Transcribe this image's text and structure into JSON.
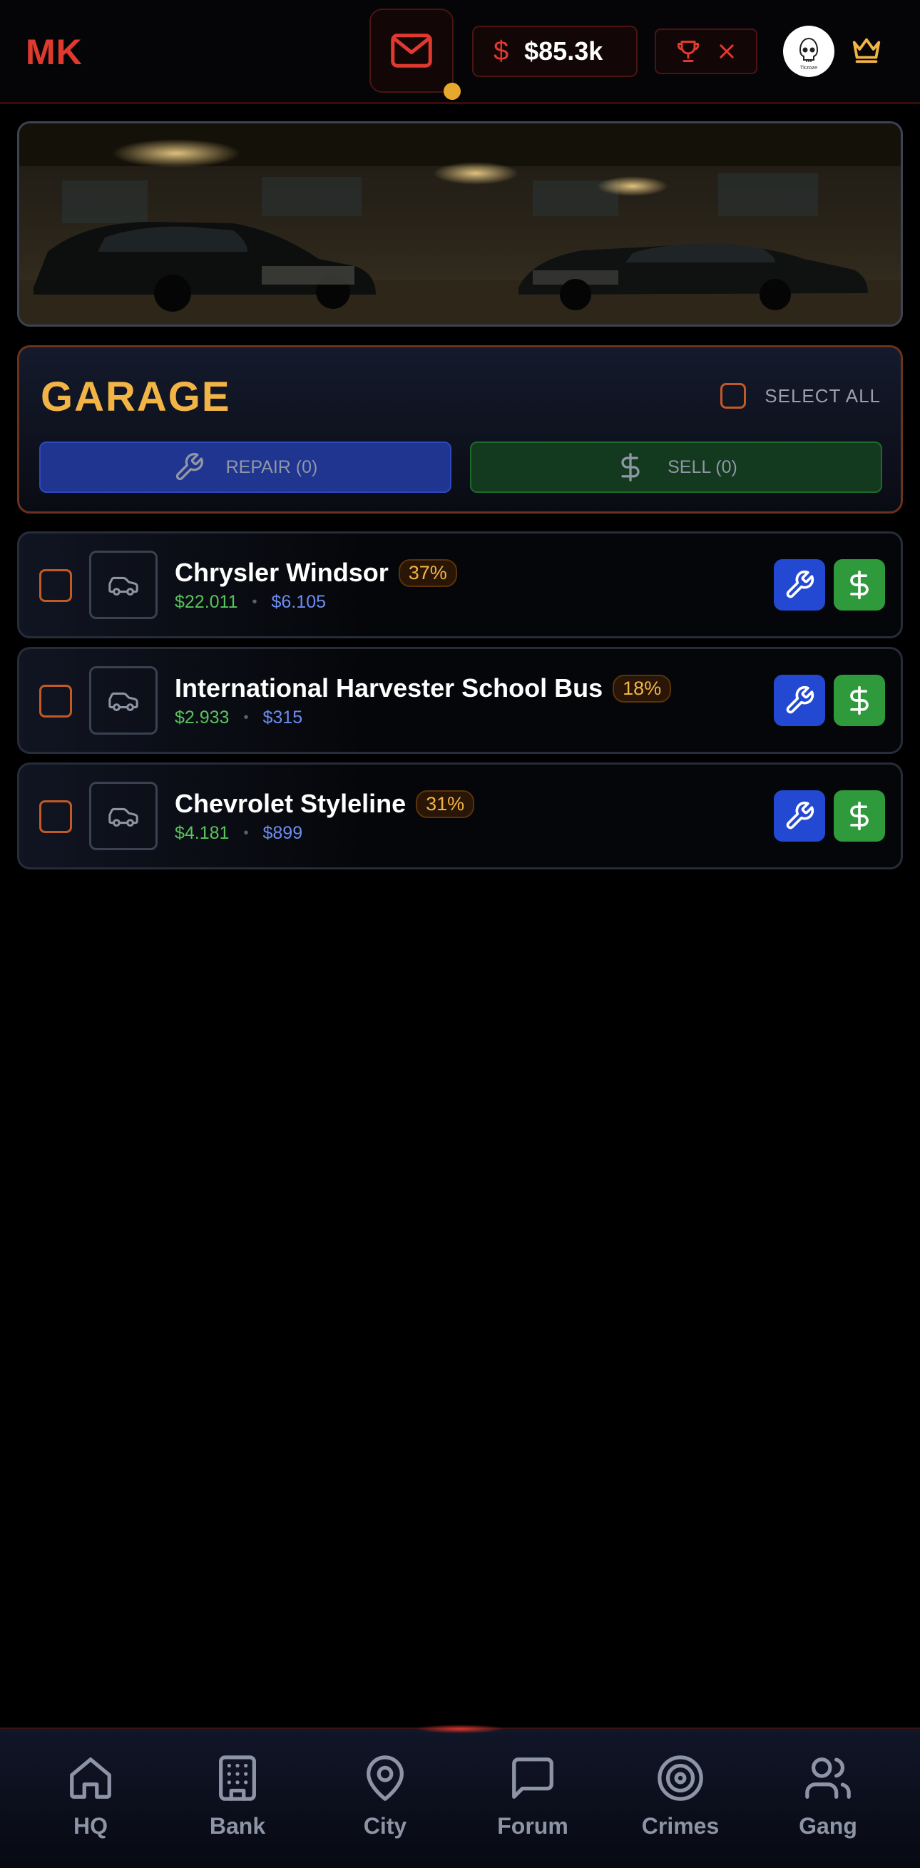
{
  "header": {
    "logo": "MK",
    "money_symbol": "$",
    "money": "$85.3k",
    "avatar_text": "Tkzoze"
  },
  "garage": {
    "title": "GARAGE",
    "select_all": "SELECT ALL",
    "repair_label": "REPAIR (0)",
    "sell_label": "SELL (0)"
  },
  "cars": [
    {
      "name": "Chrysler Windsor",
      "condition": "37%",
      "value": "$22.011",
      "repair_cost": "$6.105"
    },
    {
      "name": "International Harvester School Bus",
      "condition": "18%",
      "value": "$2.933",
      "repair_cost": "$315"
    },
    {
      "name": "Chevrolet Styleline",
      "condition": "31%",
      "value": "$4.181",
      "repair_cost": "$899"
    }
  ],
  "nav": {
    "items": [
      {
        "label": "HQ",
        "icon": "home-icon"
      },
      {
        "label": "Bank",
        "icon": "building-icon"
      },
      {
        "label": "City",
        "icon": "map-pin-icon"
      },
      {
        "label": "Forum",
        "icon": "message-square-icon"
      },
      {
        "label": "Crimes",
        "icon": "target-icon"
      },
      {
        "label": "Gang",
        "icon": "users-icon"
      }
    ]
  },
  "colors": {
    "accent_red": "#e03a2f",
    "gold": "#f2b545",
    "repair_blue": "#2349d2",
    "sell_green": "#2e9a3c",
    "checkbox_orange": "#c25a26"
  }
}
